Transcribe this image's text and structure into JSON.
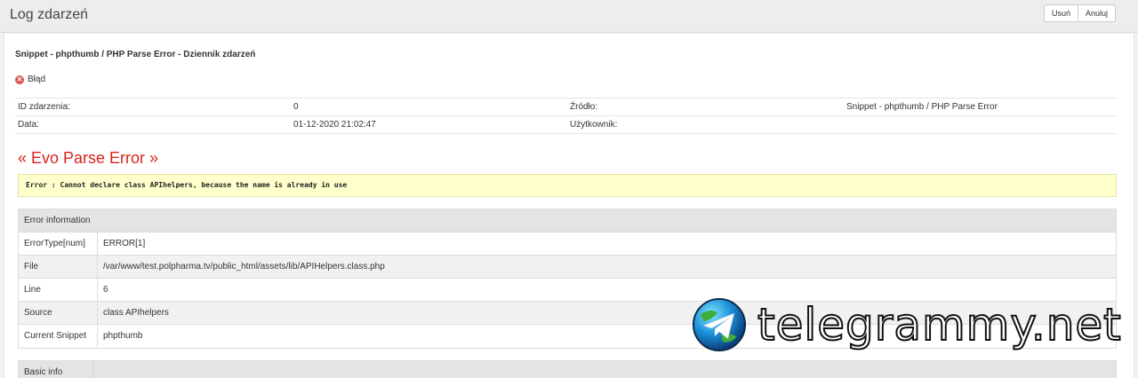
{
  "header": {
    "title": "Log zdarzeń",
    "buttons": {
      "delete": "Usuń",
      "cancel": "Anuluj"
    }
  },
  "event": {
    "subtitle": "Snippet - phpthumb / PHP Parse Error - Dziennik zdarzeń",
    "status": "Błąd",
    "info": {
      "id_label": "ID zdarzenia:",
      "id_value": "0",
      "source_label": "Źródło:",
      "source_value": "Snippet - phpthumb / PHP Parse Error",
      "date_label": "Data:",
      "date_value": "01-12-2020 21:02:47",
      "user_label": "Użytkownik:",
      "user_value": ""
    }
  },
  "error": {
    "title": "« Evo Parse Error »",
    "message": "Error : Cannot declare class APIhelpers, because the name is already in use",
    "table_title": "Error information",
    "rows": [
      {
        "label": "ErrorType[num]",
        "value": "ERROR[1]"
      },
      {
        "label": "File",
        "value": "/var/www/test.polpharma.tv/public_html/assets/lib/APIHelpers.class.php"
      },
      {
        "label": "Line",
        "value": "6"
      },
      {
        "label": "Source",
        "value": "class APIhelpers"
      },
      {
        "label": "Current Snippet",
        "value": "phpthumb"
      }
    ]
  },
  "basic": {
    "title": "Basic info"
  },
  "watermark": {
    "text": "telegrammy.net"
  },
  "colors": {
    "error_red": "#d9231d",
    "notice_yellow": "#ffffcc"
  }
}
